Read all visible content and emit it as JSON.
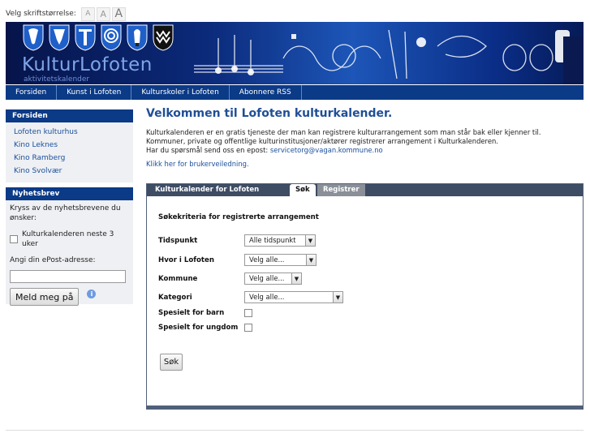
{
  "font_bar": {
    "label": "Velg skriftstørrelse:",
    "sizes": [
      "A",
      "A",
      "A"
    ]
  },
  "banner": {
    "title": "KulturLofoten",
    "subtitle": "aktivitetskalender",
    "colors": {
      "bg_dark": "#06144a",
      "bg_mid": "#1d56b8",
      "title": "#7fa4e6"
    }
  },
  "nav": {
    "items": [
      "Forsiden",
      "Kunst i Lofoten",
      "Kulturskoler i Lofoten",
      "Abonnere RSS"
    ]
  },
  "sidebar": {
    "forsiden": {
      "title": "Forsiden",
      "links": [
        "Lofoten kulturhus",
        "Kino Leknes",
        "Kino Ramberg",
        "Kino Svolvær"
      ]
    },
    "newsletter": {
      "title": "Nyhetsbrev",
      "intro": "Kryss av de nyhetsbrevene du ønsker:",
      "checkbox_label": "Kulturkalenderen neste 3 uker",
      "email_label": "Angi din ePost-adresse:",
      "email_value": "",
      "submit_label": "Meld meg på",
      "info_glyph": "i"
    }
  },
  "main": {
    "heading": "Velkommen til Lofoten kulturkalender.",
    "intro_line1": "Kulturkalenderen er en gratis tjeneste der man kan registrere kulturarrangement som man står bak eller kjenner til.",
    "intro_line2": "Kommuner, private og offentlige kulturinstitusjoner/aktører registrerer arrangement i Kulturkalenderen.",
    "intro_line3": "Har du spørsmål send oss en epost:",
    "email": "servicetorg@vagan.kommune.no",
    "manual_link": "Klikk her for brukerveiledning."
  },
  "search_panel": {
    "title": "Kulturkalender for Lofoten",
    "tabs": [
      "Søk",
      "Registrer"
    ],
    "active_tab": "Søk",
    "form_title": "Søkekriteria for registrerte arrangement",
    "fields": {
      "tidspunkt": {
        "label": "Tidspunkt",
        "value": "Alle tidspunkt"
      },
      "hvor": {
        "label": "Hvor i Lofoten",
        "value": "Velg alle..."
      },
      "kommune": {
        "label": "Kommune",
        "value": "Velg alle..."
      },
      "kategori": {
        "label": "Kategori",
        "value": "Velg alle..."
      },
      "barn": {
        "label": "Spesielt for barn",
        "checked": false
      },
      "ungdom": {
        "label": "Spesielt for ungdom",
        "checked": false
      }
    },
    "submit_label": "Søk",
    "dropdown_glyph": "▼"
  }
}
